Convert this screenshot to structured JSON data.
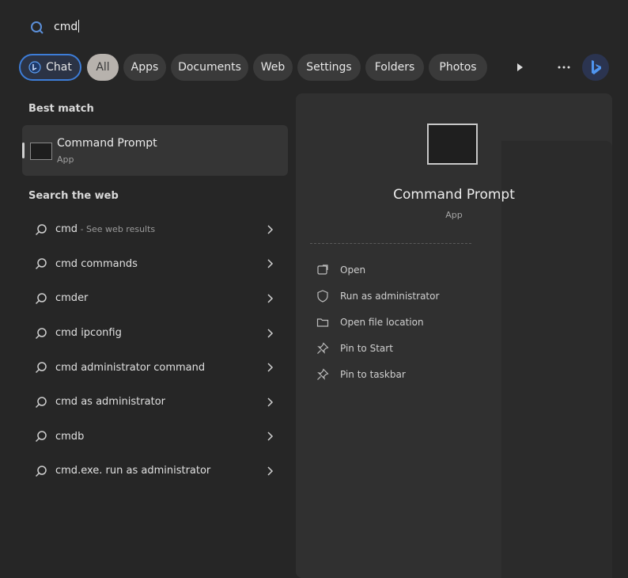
{
  "search": {
    "query": "cmd"
  },
  "filters": {
    "chat": "Chat",
    "all": "All",
    "apps": "Apps",
    "documents": "Documents",
    "web": "Web",
    "settings": "Settings",
    "folders": "Folders",
    "photos": "Photos"
  },
  "best_match": {
    "section_title": "Best match",
    "title": "Command Prompt",
    "subtitle": "App"
  },
  "search_web": {
    "section_title": "Search the web",
    "items": [
      {
        "label": "cmd",
        "suffix": " - See web results"
      },
      {
        "label": "cmd commands",
        "suffix": ""
      },
      {
        "label": "cmder",
        "suffix": ""
      },
      {
        "label": "cmd ipconfig",
        "suffix": ""
      },
      {
        "label": "cmd administrator command",
        "suffix": ""
      },
      {
        "label": "cmd as administrator",
        "suffix": ""
      },
      {
        "label": "cmdb",
        "suffix": ""
      },
      {
        "label": "cmd.exe. run as administrator",
        "suffix": ""
      }
    ]
  },
  "detail": {
    "title": "Command Prompt",
    "subtitle": "App",
    "actions": [
      {
        "label": "Open",
        "icon": "open-icon"
      },
      {
        "label": "Run as administrator",
        "icon": "shield-icon"
      },
      {
        "label": "Open file location",
        "icon": "folder-icon"
      },
      {
        "label": "Pin to Start",
        "icon": "pin-icon"
      },
      {
        "label": "Pin to taskbar",
        "icon": "pin-icon"
      }
    ]
  },
  "colors": {
    "background": "#262626",
    "accent": "#3d7dd8",
    "panel": "#303030"
  }
}
